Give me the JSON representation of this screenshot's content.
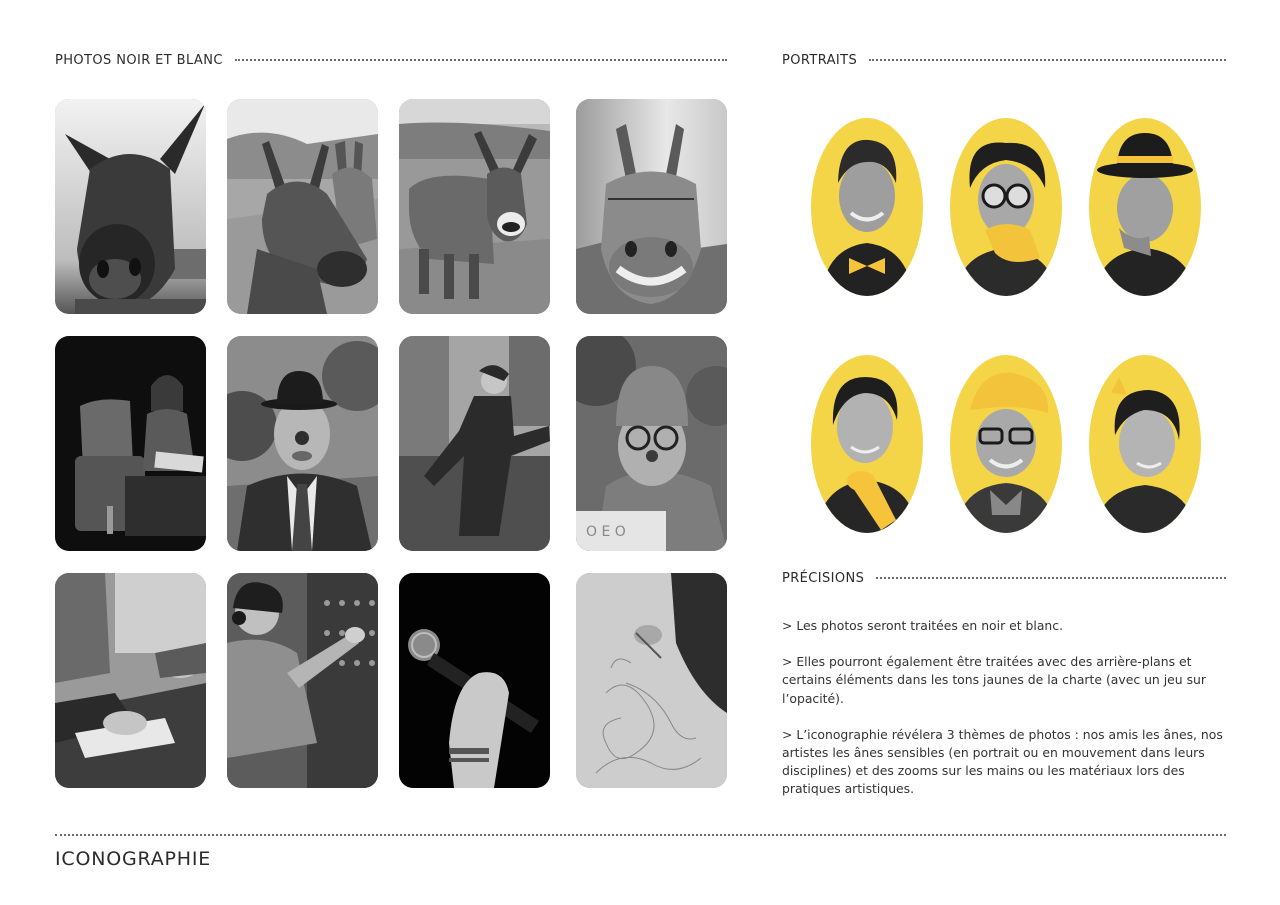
{
  "sections": {
    "photos_title": "PHOTOS NOIR ET BLANC",
    "portraits_title": "PORTRAITS",
    "precisions_title": "PRÉCISIONS"
  },
  "precisions": {
    "p1": "> Les photos seront traitées en noir et blanc.",
    "p2": "> Elles pourront également être traitées avec des arrière-plans et certains éléments dans les tons jaunes de la charte (avec un jeu sur l’opacité).",
    "p3": "> L’iconographie révélera 3 thèmes de photos : nos amis les ânes, nos artistes les ânes sensibles (en portrait ou en mouvement dans leurs disciplines) et des zooms sur les mains ou les matériaux lors des pratiques artistiques."
  },
  "footer": {
    "title": "ICONOGRAPHIE"
  },
  "colors": {
    "accent_yellow": "#f5d548",
    "text": "#2b2b2b"
  },
  "photos": [
    {
      "subject": "donkey-closeup-photo"
    },
    {
      "subject": "two-donkeys-photo"
    },
    {
      "subject": "donkey-braying-field-photo"
    },
    {
      "subject": "donkey-grinning-photo"
    },
    {
      "subject": "woman-armchair-reading-photo"
    },
    {
      "subject": "clown-bowler-hat-photo"
    },
    {
      "subject": "dancer-outdoor-photo"
    },
    {
      "subject": "clown-woman-hat-photo"
    },
    {
      "subject": "hands-writing-photo"
    },
    {
      "subject": "woman-headphones-mixing-photo"
    },
    {
      "subject": "hand-microphone-photo"
    },
    {
      "subject": "hand-drawing-photo"
    }
  ],
  "portraits": [
    {
      "subject": "man-yellow-bowtie-portrait"
    },
    {
      "subject": "woman-glasses-yellow-hand-portrait"
    },
    {
      "subject": "man-yellow-bowler-hat-portrait"
    },
    {
      "subject": "woman-yellow-microphone-portrait"
    },
    {
      "subject": "man-yellow-beret-portrait"
    },
    {
      "subject": "woman-short-hair-portrait"
    }
  ]
}
